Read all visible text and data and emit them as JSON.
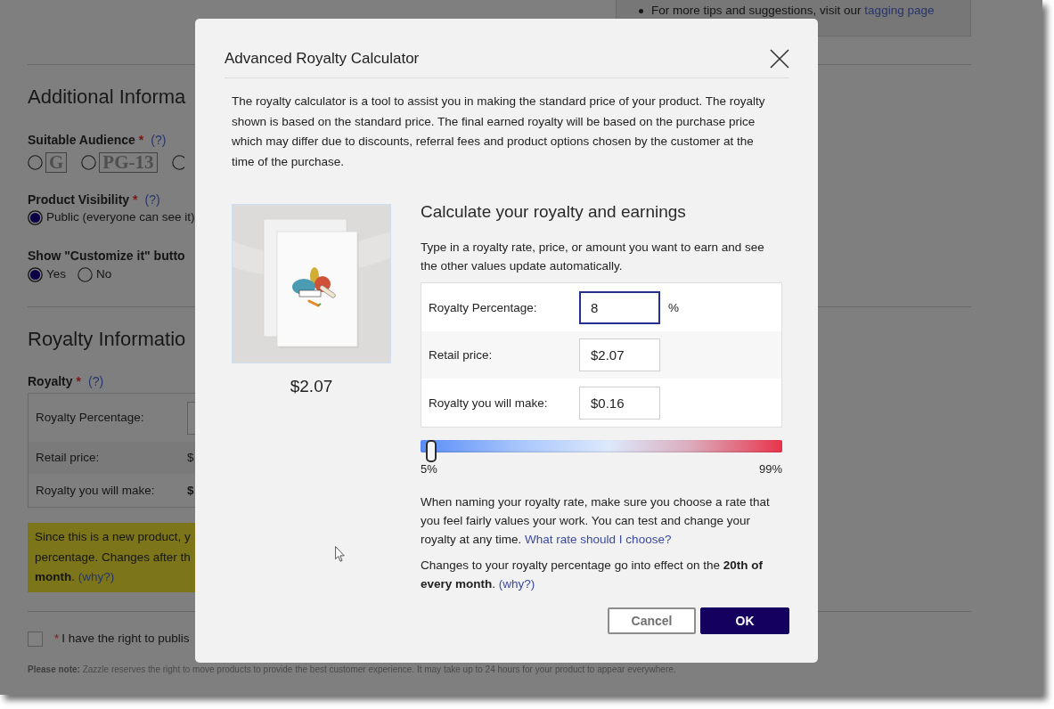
{
  "background_page": {
    "tips": {
      "text": "For more tips and suggestions, visit our",
      "link": "tagging page"
    },
    "additional_information": {
      "heading": "Additional Informa",
      "suitable_audience": {
        "label": "Suitable Audience",
        "required_mark": "*",
        "help": "(?)",
        "options": [
          {
            "label": "G",
            "selected": false
          },
          {
            "label": "PG-13",
            "selected": false
          },
          {
            "selected": false
          }
        ]
      },
      "product_visibility": {
        "label": "Product Visibility",
        "required_mark": "*",
        "help": "(?)",
        "options": [
          {
            "label": "Public (everyone can see it)",
            "selected": true
          }
        ]
      },
      "customize_button": {
        "label": "Show \"Customize it\" butto",
        "options": [
          {
            "label": "Yes",
            "selected": true
          },
          {
            "label": "No",
            "selected": false
          }
        ]
      }
    },
    "royalty_information": {
      "heading": "Royalty Informatio",
      "label": "Royalty",
      "required_mark": "*",
      "help": "(?)",
      "rows": [
        {
          "label": "Royalty Percentage:",
          "kind": "input"
        },
        {
          "label": "Retail price:",
          "kind": "text",
          "value": "$"
        },
        {
          "label": "Royalty you will make:",
          "kind": "strong",
          "value": "$"
        }
      ],
      "notice": {
        "lines": [
          "Since this is a new product, y",
          "percentage. Changes after th",
          "**month**."
        ],
        "link": "(why?)"
      }
    },
    "agreement": {
      "checked": false,
      "required_mark": "*",
      "label": "I have the right to publis"
    },
    "note": "**Please note:** Zazzle reserves the right to move products to provide the best customer experience. It may take up to 24 hours for your product to appear everywhere."
  },
  "dialog": {
    "title": "Advanced Royalty Calculator",
    "intro": "The royalty calculator is a tool to assist you in making the standard price of your product. The royalty shown is based on the standard price. The final earned royalty will be based on the purchase price which may differ due to discounts, referral fees and product options chosen by the customer at the time of the purchase.",
    "product": {
      "price": "$2.07"
    },
    "calculator": {
      "heading": "Calculate your royalty and earnings",
      "hint": "Type in a royalty rate, price, or amount you want to earn and see the other values update automatically.",
      "rows": [
        {
          "label": "Royalty Percentage:",
          "value": "8",
          "unit": "%",
          "focused": true
        },
        {
          "label": "Retail price:",
          "value": "$2.07",
          "focused": false
        },
        {
          "label": "Royalty you will make:",
          "value": "$0.16",
          "focused": false
        }
      ],
      "slider": {
        "level": 0.03,
        "min_label": "5%",
        "max_label": "99%"
      },
      "advice": {
        "text": "When naming your royalty rate, make sure you choose a rate that you feel fairly values your work. You can test and change your royalty at any time.",
        "link": "What rate should I choose?"
      },
      "schedule": {
        "text": "Changes to your royalty percentage go into effect on the **20th of every month**.",
        "link": "(why?)"
      }
    },
    "buttons": [
      {
        "label": "Cancel",
        "kind": "secondary"
      },
      {
        "label": "OK",
        "kind": "primary"
      }
    ]
  }
}
